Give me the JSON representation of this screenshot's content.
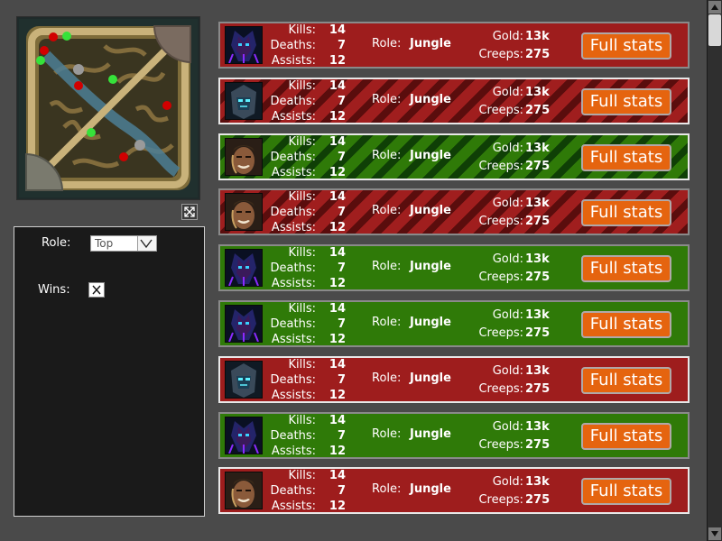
{
  "filters": {
    "role_label": "Role:",
    "role_value": "Top",
    "wins_label": "Wins:",
    "wins_checked": true
  },
  "labels": {
    "kills": "Kills:",
    "deaths": "Deaths:",
    "assists": "Assists:",
    "role": "Role:",
    "gold": "Gold:",
    "creeps": "Creeps:",
    "full_stats": "Full stats"
  },
  "matches": [
    {
      "result": "loss",
      "striped": false,
      "highlight": false,
      "champion_icon": "kassadin-portrait-icon",
      "kills": "14",
      "deaths": "7",
      "assists": "12",
      "role": "Jungle",
      "gold": "13k",
      "creeps": "275"
    },
    {
      "result": "loss",
      "striped": true,
      "highlight": true,
      "champion_icon": "kassadin-helmet-portrait-icon",
      "kills": "14",
      "deaths": "7",
      "assists": "12",
      "role": "Jungle",
      "gold": "13k",
      "creeps": "275"
    },
    {
      "result": "win",
      "striped": true,
      "highlight": true,
      "champion_icon": "draven-portrait-icon",
      "kills": "14",
      "deaths": "7",
      "assists": "12",
      "role": "Jungle",
      "gold": "13k",
      "creeps": "275"
    },
    {
      "result": "loss",
      "striped": true,
      "highlight": false,
      "champion_icon": "draven-portrait-icon",
      "kills": "14",
      "deaths": "7",
      "assists": "12",
      "role": "Jungle",
      "gold": "13k",
      "creeps": "275"
    },
    {
      "result": "win",
      "striped": false,
      "highlight": false,
      "champion_icon": "kassadin-portrait-icon",
      "kills": "14",
      "deaths": "7",
      "assists": "12",
      "role": "Jungle",
      "gold": "13k",
      "creeps": "275"
    },
    {
      "result": "win",
      "striped": false,
      "highlight": false,
      "champion_icon": "kassadin-portrait-icon",
      "kills": "14",
      "deaths": "7",
      "assists": "12",
      "role": "Jungle",
      "gold": "13k",
      "creeps": "275"
    },
    {
      "result": "loss",
      "striped": false,
      "highlight": true,
      "champion_icon": "kassadin-helmet-portrait-icon",
      "kills": "14",
      "deaths": "7",
      "assists": "12",
      "role": "Jungle",
      "gold": "13k",
      "creeps": "275"
    },
    {
      "result": "win",
      "striped": false,
      "highlight": false,
      "champion_icon": "kassadin-portrait-icon",
      "kills": "14",
      "deaths": "7",
      "assists": "12",
      "role": "Jungle",
      "gold": "13k",
      "creeps": "275"
    },
    {
      "result": "loss",
      "striped": false,
      "highlight": true,
      "champion_icon": "draven-portrait-icon",
      "kills": "14",
      "deaths": "7",
      "assists": "12",
      "role": "Jungle",
      "gold": "13k",
      "creeps": "275"
    }
  ],
  "colors": {
    "win": "#2f7a08",
    "loss": "#9e1d1d",
    "button": "#e5640f",
    "red_team_marker": "#d10000",
    "green_team_marker": "#36e23a"
  }
}
